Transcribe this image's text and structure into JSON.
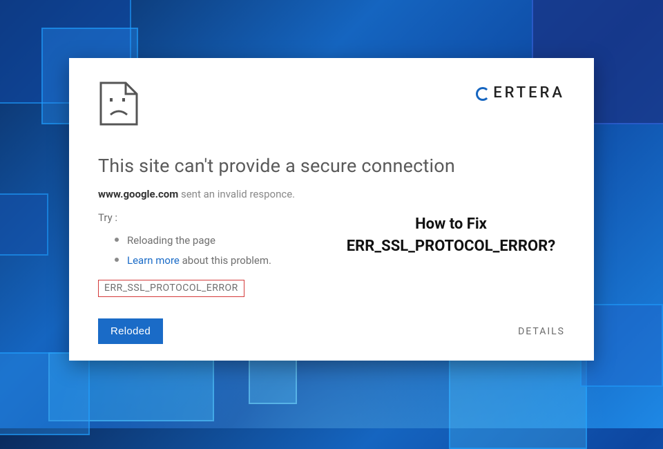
{
  "brand": {
    "name": "ERTERA"
  },
  "error": {
    "heading": "This site can't provide a secure connection",
    "host": "www.google.com",
    "host_suffix": " sent an invalid responce.",
    "try_label": "Try :",
    "suggestions": {
      "reload": "Reloading the page",
      "learn_more_link": "Learn more",
      "learn_more_suffix": " about this problem."
    },
    "code": "ERR_SSL_PROTOCOL_ERROR"
  },
  "overlay": {
    "line1": "How to Fix",
    "line2": "ERR_SSL_PROTOCOL_ERROR?"
  },
  "actions": {
    "reload": "Reloded",
    "details": "DETAILS"
  }
}
